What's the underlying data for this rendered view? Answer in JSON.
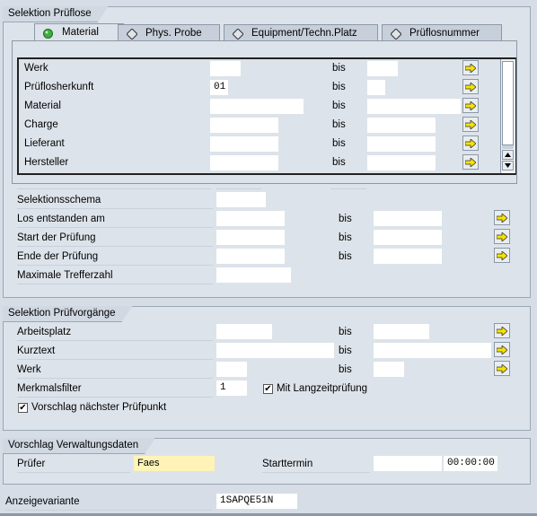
{
  "sel_prueflose": {
    "title": "Selektion Prüflose",
    "tabs": [
      {
        "label": "Material"
      },
      {
        "label": "Phys. Probe"
      },
      {
        "label": "Equipment/Techn.Platz"
      },
      {
        "label": "Prüflosnummer"
      }
    ],
    "bis_label": "bis",
    "rows": [
      {
        "label": "Werk",
        "from": "",
        "to": ""
      },
      {
        "label": "Prüflosherkunft",
        "from": "01",
        "to": ""
      },
      {
        "label": "Material",
        "from": "",
        "to": ""
      },
      {
        "label": "Charge",
        "from": "",
        "to": ""
      },
      {
        "label": "Lieferant",
        "from": "",
        "to": ""
      },
      {
        "label": "Hersteller",
        "from": "",
        "to": ""
      }
    ],
    "selektionsschema_label": "Selektionsschema",
    "selektionsschema_value": "",
    "los_entstanden_label": "Los entstanden am",
    "start_pruefung_label": "Start der Prüfung",
    "ende_pruefung_label": "Ende der Prüfung",
    "max_treffer_label": "Maximale Trefferzahl",
    "max_treffer_value": ""
  },
  "sel_pruefvorgaenge": {
    "title": "Selektion Prüfvorgänge",
    "arbeitsplatz_label": "Arbeitsplatz",
    "kurztext_label": "Kurztext",
    "werk_label": "Werk",
    "merkmalsfilter_label": "Merkmalsfilter",
    "merkmalsfilter_value": "1",
    "langzeit_label": "Mit Langzeitprüfung",
    "langzeit_checked": "✔",
    "vorschlag_label": "Vorschlag nächster Prüfpunkt",
    "vorschlag_checked": "✔",
    "bis_label": "bis"
  },
  "vorschlag": {
    "title": "Vorschlag Verwaltungsdaten",
    "pruefer_label": "Prüfer",
    "pruefer_value": "Faes",
    "starttermin_label": "Starttermin",
    "starttermin_date": "",
    "starttermin_time": "00:00:00"
  },
  "anzeige": {
    "label": "Anzeigevariante",
    "value": "1SAPQE51N"
  },
  "colors": {
    "background": "#d6dde6",
    "group_bg": "#dde3ea",
    "field_bg": "#ffffff",
    "required_bg": "#fff3b8",
    "tab_active_dot": "#3fae3f"
  }
}
